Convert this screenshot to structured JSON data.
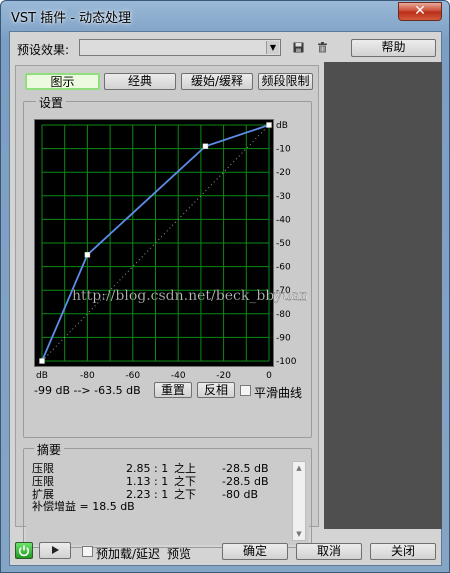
{
  "window": {
    "title": "VST 插件 - 动态处理",
    "close_glyph": "✕"
  },
  "toolbar": {
    "preset_label": "预设效果:",
    "preset_value": "",
    "save_icon": "save-icon",
    "delete_icon": "trash-icon",
    "help_label": "帮助"
  },
  "tabs": [
    {
      "label": "图示",
      "active": true
    },
    {
      "label": "经典",
      "active": false
    },
    {
      "label": "缓始/缓释",
      "active": false
    },
    {
      "label": "频段限制",
      "active": false
    }
  ],
  "settings": {
    "title": "设置",
    "y_ticks": [
      "dB",
      "-10",
      "-20",
      "-30",
      "-40",
      "-50",
      "-60",
      "-70",
      "-80",
      "-90",
      "-100"
    ],
    "x_ticks": [
      "dB",
      "-80",
      "-60",
      "-40",
      "-20",
      "0"
    ],
    "readout": "-99 dB --> -63.5 dB",
    "reset_label": "重置",
    "invert_label": "反相",
    "smooth_label": "平滑曲线",
    "smooth_checked": false,
    "watermark": "http://blog.csdn.net/beck_bbyuan"
  },
  "chart_data": {
    "type": "line",
    "xlabel": "dB",
    "ylabel": "dB",
    "xlim": [
      -100,
      0
    ],
    "ylim": [
      -100,
      0
    ],
    "grid": true,
    "series": [
      {
        "x": [
          -100,
          -80,
          -28,
          0
        ],
        "y": [
          -100,
          -55,
          -9,
          0
        ]
      }
    ],
    "reference": {
      "x": [
        -100,
        0
      ],
      "y": [
        -100,
        0
      ],
      "style": "dotted"
    },
    "colors": {
      "background": "#000000",
      "grid": "#0b8a16",
      "curve": "#5b8ee8",
      "axis_text": "#000000"
    }
  },
  "summary": {
    "title": "摘要",
    "rows": [
      {
        "type": "压限",
        "ratio": "2.85 : 1",
        "dir": "之上",
        "thresh": "-28.5 dB"
      },
      {
        "type": "压限",
        "ratio": "1.13 : 1",
        "dir": "之下",
        "thresh": "-28.5 dB"
      },
      {
        "type": "扩展",
        "ratio": "2.23 : 1",
        "dir": "之下",
        "thresh": "-80 dB"
      }
    ],
    "makeup": "补偿增益 = 18.5 dB"
  },
  "footer": {
    "power_icon": "power-icon",
    "play_icon": "play-icon",
    "preload_label": "预加载/延迟",
    "preload_checked": false,
    "preview_label": "预览",
    "ok_label": "确定",
    "cancel_label": "取消",
    "close_label": "关闭"
  }
}
